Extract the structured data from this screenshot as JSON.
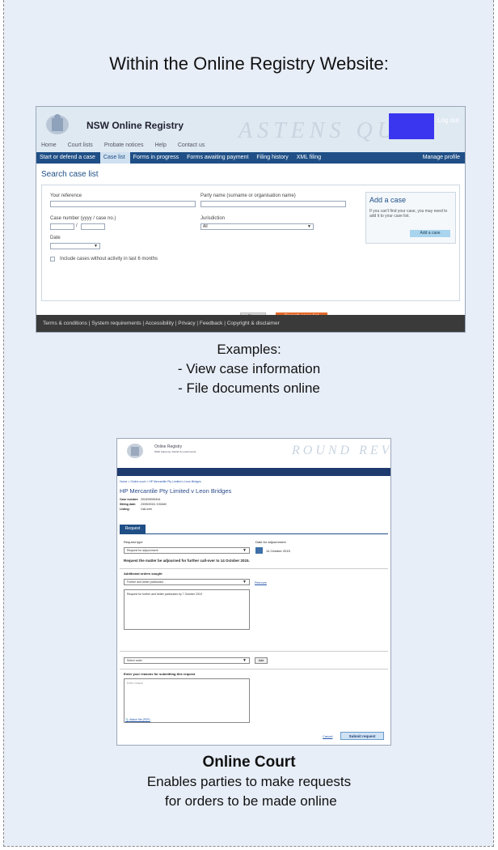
{
  "heading": "Within the Online Registry Website:",
  "registry": {
    "title": "NSW Online Registry",
    "watermark": "ASTENS QUAY",
    "logout": "Log out",
    "top_links": [
      "Home",
      "Court lists",
      "Probate notices",
      "Help",
      "Contact us"
    ],
    "nav_tabs": [
      "Start or defend a case",
      "Case list",
      "Forms in progress",
      "Forms awaiting payment",
      "Filing history",
      "XML filing"
    ],
    "nav_active_index": 1,
    "nav_right": "Manage profile",
    "page_title": "Search case list",
    "fields": {
      "your_reference": "Your reference",
      "party_name": "Party name (surname or organisation name)",
      "case_number": "Case number (yyyy / case no.)",
      "jurisdiction": "Jurisdiction",
      "jurisdiction_value": "All",
      "date": "Date",
      "include_inactive": "Include cases without activity in last 6 months"
    },
    "add_case": {
      "title": "Add a case",
      "desc": "If you can't find your case, you may need to add it to your case list.",
      "button": "Add a case"
    },
    "buttons": {
      "clear": "Clear",
      "search": "Search case list"
    },
    "footer": "Terms & conditions  |  System requirements  |  Accessibility  |  Privacy  |  Feedback  |  Copyright & disclaimer"
  },
  "caption1": [
    "Examples:",
    "- View case information",
    "- File documents online"
  ],
  "court": {
    "title_line1": "Online Registry",
    "title_line2": "NSW Supreme, District & Local Courts",
    "watermark": "ROUND REVIEWS",
    "breadcrumb": "Home > Online court > HP Mercantile Pty Limited v Leon Bridges",
    "case_title": "HP Mercantile Pty Limited v Leon Bridges",
    "details": [
      {
        "k": "Case number:",
        "v": "2015/00000444"
      },
      {
        "k": "Sitting date:",
        "v": "23/09/2015, 9:30AM"
      },
      {
        "k": "Listing:",
        "v": "Call-over"
      }
    ],
    "tab": "Request",
    "request_type_label": "Request type",
    "request_type_value": "Request for adjournment",
    "date_label": "Date for adjournment",
    "date_value": "14 October 2015",
    "request_sentence": "Request the matter be adjourned for further call-over to 14 October 2015.",
    "additional_label": "Additional orders sought",
    "additional_value": "Further and better particulars",
    "remove": "Remove",
    "additional_text": "Request for further and better particulars by 7 October 2015",
    "select_order": "Select order",
    "add": "Add",
    "reasons_label": "Enter your reasons for submitting this request",
    "reasons_placeholder": "Enter reason",
    "attach": "Attach file (PDF)",
    "cancel": "Cancel",
    "submit": "Submit request"
  },
  "caption2": {
    "title": "Online Court",
    "lines": [
      "Enables parties to make requests",
      " for orders to be made online"
    ]
  },
  "colors": {
    "nav": "#1f4f86",
    "accent": "#e46a2a",
    "background": "#e8eef8",
    "blue_block": "#3a36f0"
  }
}
